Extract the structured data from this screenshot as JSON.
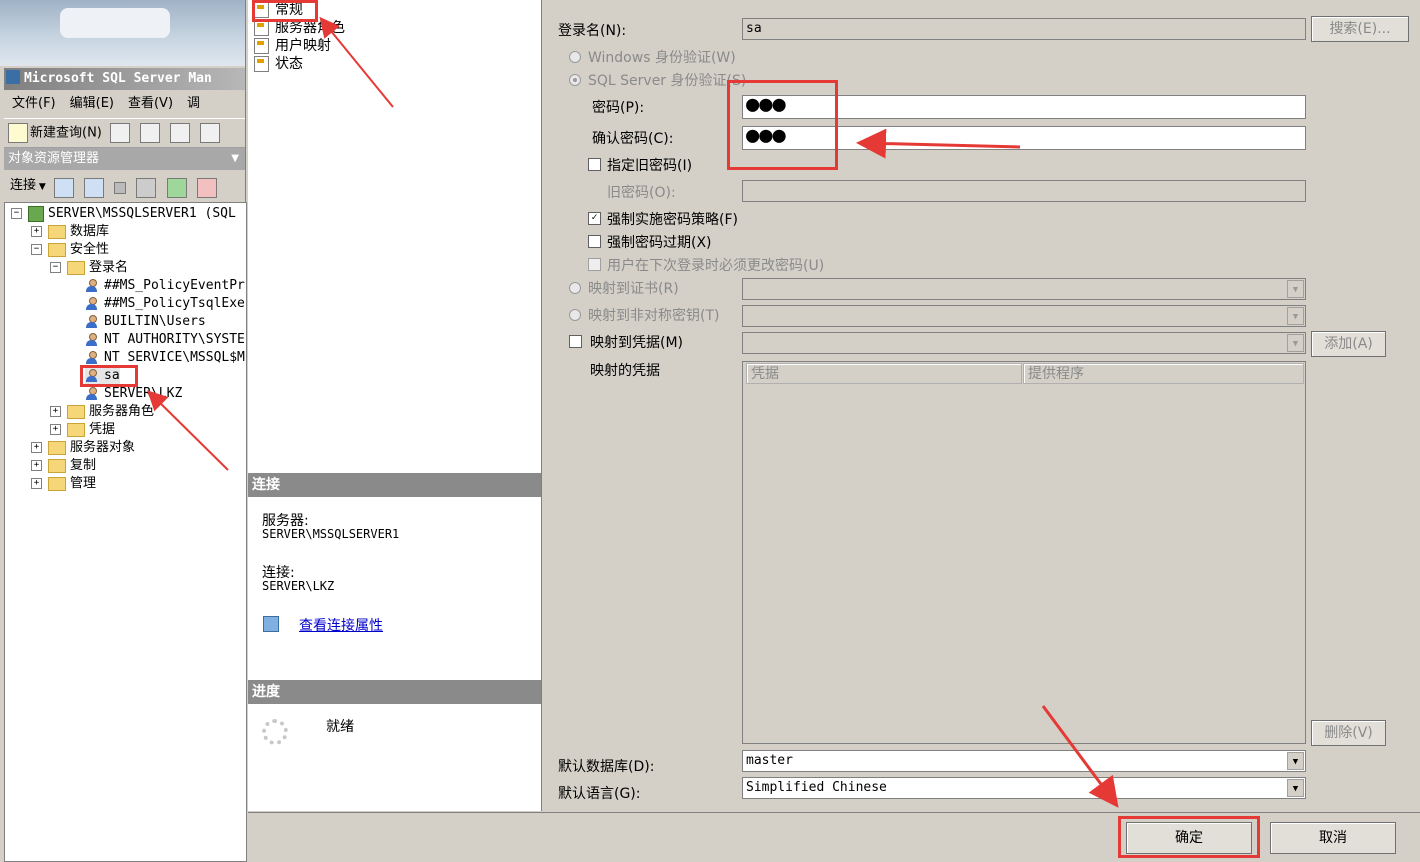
{
  "left_pane": {
    "ssms_title": "Microsoft SQL Server Man",
    "menu": [
      "文件(F)",
      "编辑(E)",
      "查看(V)",
      "调"
    ],
    "toolbar_new_query": "新建查询(N)",
    "oe_title": "对象资源管理器",
    "oe_connect": "连接",
    "tree": {
      "server": "SERVER\\MSSQLSERVER1 (SQL",
      "databases": "数据库",
      "security": "安全性",
      "logins": "登录名",
      "login_items": [
        "##MS_PolicyEventPr",
        "##MS_PolicyTsqlExe",
        "BUILTIN\\Users",
        "NT AUTHORITY\\SYSTE",
        "NT SERVICE\\MSSQL$M",
        "sa",
        "SERVER\\LKZ"
      ],
      "server_roles": "服务器角色",
      "credentials": "凭据",
      "server_objects": "服务器对象",
      "replication": "复制",
      "management": "管理"
    }
  },
  "middle_pane": {
    "pages": [
      "常规",
      "服务器角色",
      "用户映射",
      "状态"
    ],
    "connection_header": "连接",
    "server_label": "服务器:",
    "server_value": "SERVER\\MSSQLSERVER1",
    "connection_label": "连接:",
    "connection_value": "SERVER\\LKZ",
    "view_props_link": "查看连接属性",
    "progress_header": "进度",
    "progress_status": "就绪"
  },
  "form": {
    "login_name_label": "登录名(N):",
    "login_name_value": "sa",
    "search_button": "搜索(E)...",
    "windows_auth": "Windows 身份验证(W)",
    "sql_auth": "SQL Server 身份验证(S)",
    "password_label": "密码(P):",
    "password_value": "●●●",
    "confirm_label": "确认密码(C):",
    "confirm_value": "●●●",
    "specify_old": "指定旧密码(I)",
    "old_password_label": "旧密码(O):",
    "enforce_policy": "强制实施密码策略(F)",
    "enforce_expiration": "强制密码过期(X)",
    "must_change": "用户在下次登录时必须更改密码(U)",
    "map_cert": "映射到证书(R)",
    "map_asym": "映射到非对称密钥(T)",
    "map_credential": "映射到凭据(M)",
    "add_button": "添加(A)",
    "mapped_credentials": "映射的凭据",
    "grid_headers": [
      "凭据",
      "提供程序"
    ],
    "remove_button": "删除(V)",
    "default_db_label": "默认数据库(D):",
    "default_db_value": "master",
    "default_lang_label": "默认语言(G):",
    "default_lang_value": "Simplified Chinese"
  },
  "footer": {
    "ok": "确定",
    "cancel": "取消"
  },
  "colors": {
    "annotation_red": "#e53935",
    "dialog_bg": "#d4d0c8",
    "link_blue": "#0000cc"
  }
}
